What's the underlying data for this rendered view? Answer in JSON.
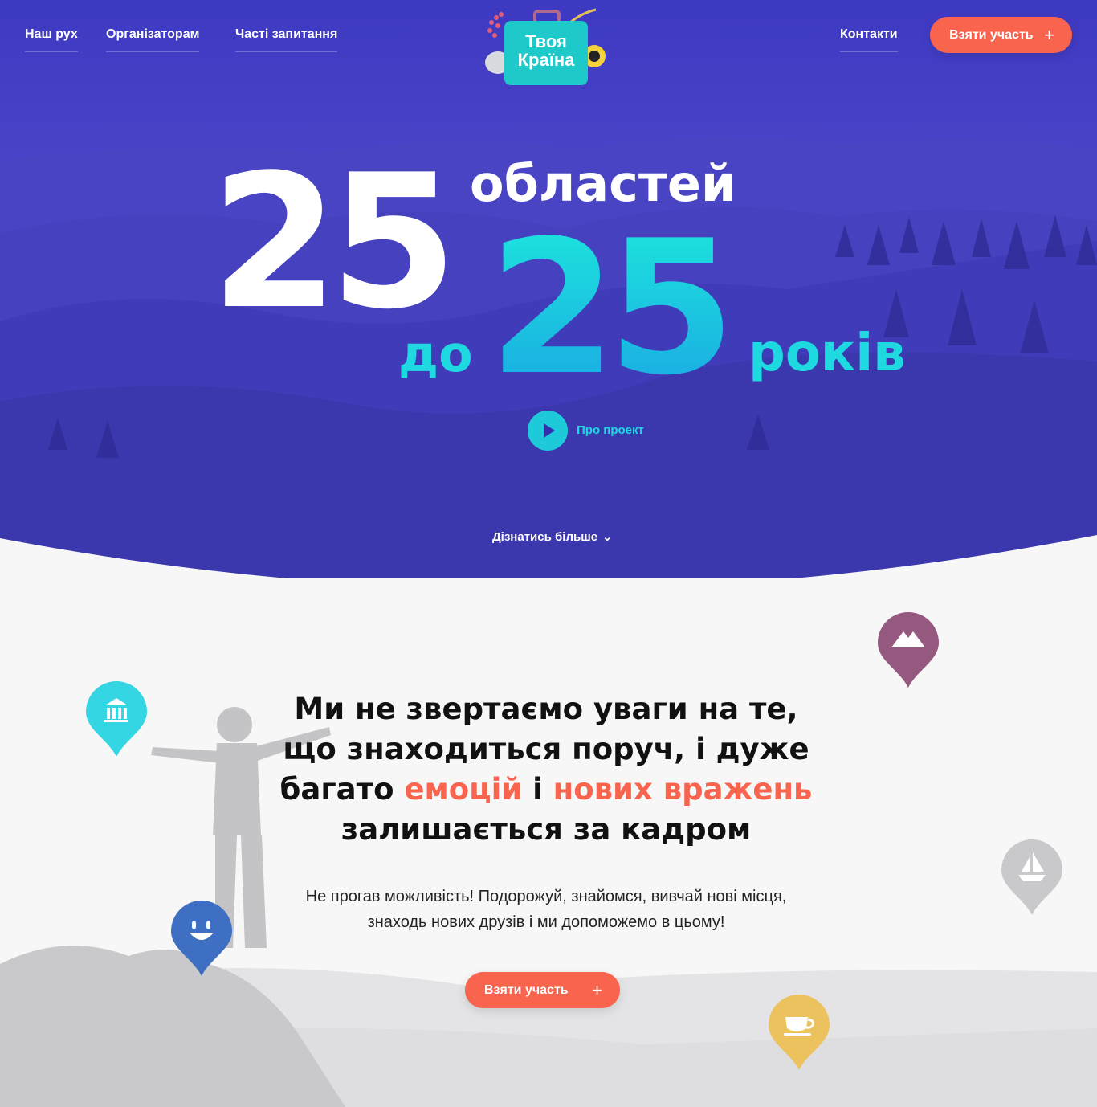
{
  "nav": {
    "left": [
      "Наш рух",
      "Організаторам",
      "Часті запитання"
    ],
    "contacts": "Контакти",
    "cta": "Взяти участь",
    "cta_plus": "+"
  },
  "logo": {
    "line1": "Твоя",
    "line2": "Країна"
  },
  "hero": {
    "num1": "25",
    "word1": "областей",
    "word2": "до",
    "num2": "25",
    "word3": "років",
    "play_label": "Про проект",
    "more_label": "Дізнатись більше",
    "more_chevron": "⌄"
  },
  "content": {
    "headline_1": "Ми не звертаємо уваги на те,",
    "headline_2": "що знаходиться поруч, і дуже",
    "headline_3a": "багато ",
    "headline_3b": "емоцій",
    "headline_3c": " і ",
    "headline_3d": "нових вражень",
    "headline_4": "залишається за кадром",
    "sub_1": "Не прогав можливість! Подорожуй, знайомся, вивчай нові місця,",
    "sub_2": "знаходь нових друзів і ми допоможемо в цьому!",
    "cta": "Взяти участь",
    "cta_plus": "+"
  },
  "pins": [
    {
      "icon": "museum-icon",
      "color": "#35d6e3"
    },
    {
      "icon": "mountain-icon",
      "color": "#95587e"
    },
    {
      "icon": "boat-icon",
      "color": "#c9c9cc"
    },
    {
      "icon": "smile-icon",
      "color": "#3e6fc2"
    },
    {
      "icon": "coffee-icon",
      "color": "#ecc25f"
    }
  ],
  "colors": {
    "accent": "#f8644e",
    "hero": "#4a44c8",
    "cyan": "#1ec9d9"
  }
}
